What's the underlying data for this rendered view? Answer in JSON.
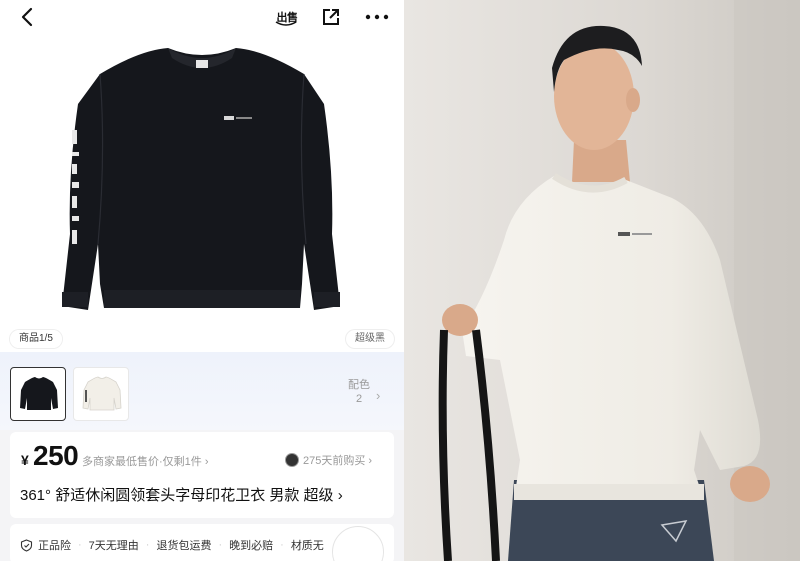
{
  "topbar": {
    "back_icon": "chevron-left-icon",
    "sell_label": "出售",
    "share_icon": "share-out-icon",
    "more_icon": "ellipsis-icon"
  },
  "gallery": {
    "page_indicator": "商品1/5",
    "color_name": "超级黑"
  },
  "colors": {
    "label": "配色",
    "count": "2",
    "chevron": "›"
  },
  "price": {
    "currency": "¥",
    "amount": "250",
    "lowest_note": "多商家最低售价·仅剩1件 ›",
    "recent_purchase": "275天前购买 ›"
  },
  "product": {
    "title": "361° 舒适休闲圆领套头字母印花卫衣 男款 超级 ›"
  },
  "guarantees": [
    "正品险",
    "7天无理由",
    "退货包运费",
    "晚到必赔",
    "材质无"
  ],
  "colors_theme": {
    "sweater_black": "#15171c",
    "sweater_white": "#f2efe8",
    "swatch_bg": "#eef2fb"
  }
}
